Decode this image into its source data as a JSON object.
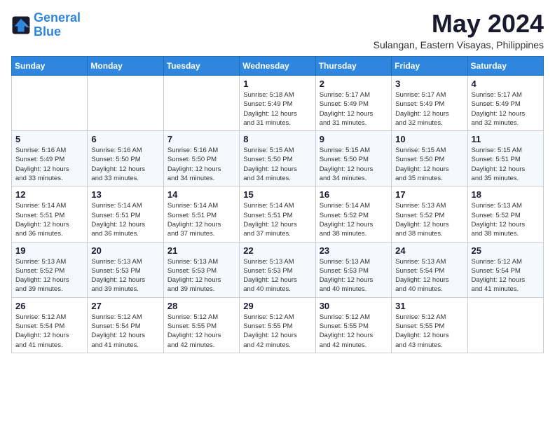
{
  "logo": {
    "line1": "General",
    "line2": "Blue"
  },
  "title": "May 2024",
  "location": "Sulangan, Eastern Visayas, Philippines",
  "days_of_week": [
    "Sunday",
    "Monday",
    "Tuesday",
    "Wednesday",
    "Thursday",
    "Friday",
    "Saturday"
  ],
  "weeks": [
    [
      {
        "day": "",
        "info": ""
      },
      {
        "day": "",
        "info": ""
      },
      {
        "day": "",
        "info": ""
      },
      {
        "day": "1",
        "info": "Sunrise: 5:18 AM\nSunset: 5:49 PM\nDaylight: 12 hours\nand 31 minutes."
      },
      {
        "day": "2",
        "info": "Sunrise: 5:17 AM\nSunset: 5:49 PM\nDaylight: 12 hours\nand 31 minutes."
      },
      {
        "day": "3",
        "info": "Sunrise: 5:17 AM\nSunset: 5:49 PM\nDaylight: 12 hours\nand 32 minutes."
      },
      {
        "day": "4",
        "info": "Sunrise: 5:17 AM\nSunset: 5:49 PM\nDaylight: 12 hours\nand 32 minutes."
      }
    ],
    [
      {
        "day": "5",
        "info": "Sunrise: 5:16 AM\nSunset: 5:49 PM\nDaylight: 12 hours\nand 33 minutes."
      },
      {
        "day": "6",
        "info": "Sunrise: 5:16 AM\nSunset: 5:50 PM\nDaylight: 12 hours\nand 33 minutes."
      },
      {
        "day": "7",
        "info": "Sunrise: 5:16 AM\nSunset: 5:50 PM\nDaylight: 12 hours\nand 34 minutes."
      },
      {
        "day": "8",
        "info": "Sunrise: 5:15 AM\nSunset: 5:50 PM\nDaylight: 12 hours\nand 34 minutes."
      },
      {
        "day": "9",
        "info": "Sunrise: 5:15 AM\nSunset: 5:50 PM\nDaylight: 12 hours\nand 34 minutes."
      },
      {
        "day": "10",
        "info": "Sunrise: 5:15 AM\nSunset: 5:50 PM\nDaylight: 12 hours\nand 35 minutes."
      },
      {
        "day": "11",
        "info": "Sunrise: 5:15 AM\nSunset: 5:51 PM\nDaylight: 12 hours\nand 35 minutes."
      }
    ],
    [
      {
        "day": "12",
        "info": "Sunrise: 5:14 AM\nSunset: 5:51 PM\nDaylight: 12 hours\nand 36 minutes."
      },
      {
        "day": "13",
        "info": "Sunrise: 5:14 AM\nSunset: 5:51 PM\nDaylight: 12 hours\nand 36 minutes."
      },
      {
        "day": "14",
        "info": "Sunrise: 5:14 AM\nSunset: 5:51 PM\nDaylight: 12 hours\nand 37 minutes."
      },
      {
        "day": "15",
        "info": "Sunrise: 5:14 AM\nSunset: 5:51 PM\nDaylight: 12 hours\nand 37 minutes."
      },
      {
        "day": "16",
        "info": "Sunrise: 5:14 AM\nSunset: 5:52 PM\nDaylight: 12 hours\nand 38 minutes."
      },
      {
        "day": "17",
        "info": "Sunrise: 5:13 AM\nSunset: 5:52 PM\nDaylight: 12 hours\nand 38 minutes."
      },
      {
        "day": "18",
        "info": "Sunrise: 5:13 AM\nSunset: 5:52 PM\nDaylight: 12 hours\nand 38 minutes."
      }
    ],
    [
      {
        "day": "19",
        "info": "Sunrise: 5:13 AM\nSunset: 5:52 PM\nDaylight: 12 hours\nand 39 minutes."
      },
      {
        "day": "20",
        "info": "Sunrise: 5:13 AM\nSunset: 5:53 PM\nDaylight: 12 hours\nand 39 minutes."
      },
      {
        "day": "21",
        "info": "Sunrise: 5:13 AM\nSunset: 5:53 PM\nDaylight: 12 hours\nand 39 minutes."
      },
      {
        "day": "22",
        "info": "Sunrise: 5:13 AM\nSunset: 5:53 PM\nDaylight: 12 hours\nand 40 minutes."
      },
      {
        "day": "23",
        "info": "Sunrise: 5:13 AM\nSunset: 5:53 PM\nDaylight: 12 hours\nand 40 minutes."
      },
      {
        "day": "24",
        "info": "Sunrise: 5:13 AM\nSunset: 5:54 PM\nDaylight: 12 hours\nand 40 minutes."
      },
      {
        "day": "25",
        "info": "Sunrise: 5:12 AM\nSunset: 5:54 PM\nDaylight: 12 hours\nand 41 minutes."
      }
    ],
    [
      {
        "day": "26",
        "info": "Sunrise: 5:12 AM\nSunset: 5:54 PM\nDaylight: 12 hours\nand 41 minutes."
      },
      {
        "day": "27",
        "info": "Sunrise: 5:12 AM\nSunset: 5:54 PM\nDaylight: 12 hours\nand 41 minutes."
      },
      {
        "day": "28",
        "info": "Sunrise: 5:12 AM\nSunset: 5:55 PM\nDaylight: 12 hours\nand 42 minutes."
      },
      {
        "day": "29",
        "info": "Sunrise: 5:12 AM\nSunset: 5:55 PM\nDaylight: 12 hours\nand 42 minutes."
      },
      {
        "day": "30",
        "info": "Sunrise: 5:12 AM\nSunset: 5:55 PM\nDaylight: 12 hours\nand 42 minutes."
      },
      {
        "day": "31",
        "info": "Sunrise: 5:12 AM\nSunset: 5:55 PM\nDaylight: 12 hours\nand 43 minutes."
      },
      {
        "day": "",
        "info": ""
      }
    ]
  ]
}
